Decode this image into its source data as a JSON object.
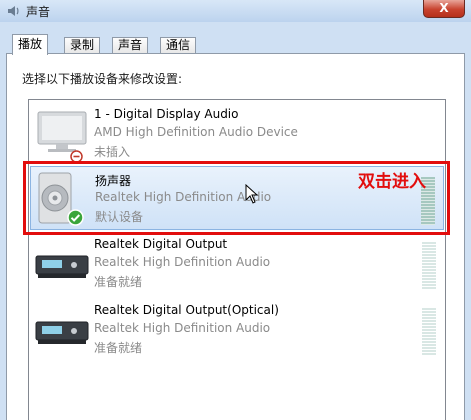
{
  "window": {
    "title": "声音",
    "close_label": "X"
  },
  "tabs": [
    {
      "label": "播放",
      "active": true
    },
    {
      "label": "录制",
      "active": false
    },
    {
      "label": "声音",
      "active": false
    },
    {
      "label": "通信",
      "active": false
    }
  ],
  "instruction": "选择以下播放设备来修改设置:",
  "devices": [
    {
      "name": "1 - Digital Display Audio",
      "driver": "AMD High Definition Audio Device",
      "status": "未插入",
      "icon": "monitor-icon",
      "badge": "disconnected-badge-icon"
    },
    {
      "name": "扬声器",
      "driver": "Realtek High Definition Audio",
      "status": "默认设备",
      "icon": "speaker-icon",
      "badge": "default-check-badge-icon"
    },
    {
      "name": "Realtek Digital Output",
      "driver": "Realtek High Definition Audio",
      "status": "准备就绪",
      "icon": "digital-output-icon"
    },
    {
      "name": "Realtek Digital Output(Optical)",
      "driver": "Realtek High Definition Audio",
      "status": "准备就绪",
      "icon": "optical-output-icon"
    }
  ],
  "annotation": {
    "callout": "双击进入",
    "color": "#e20d0d"
  },
  "colors": {
    "selection": "#cfe2f7",
    "close_button": "#c8432f"
  }
}
